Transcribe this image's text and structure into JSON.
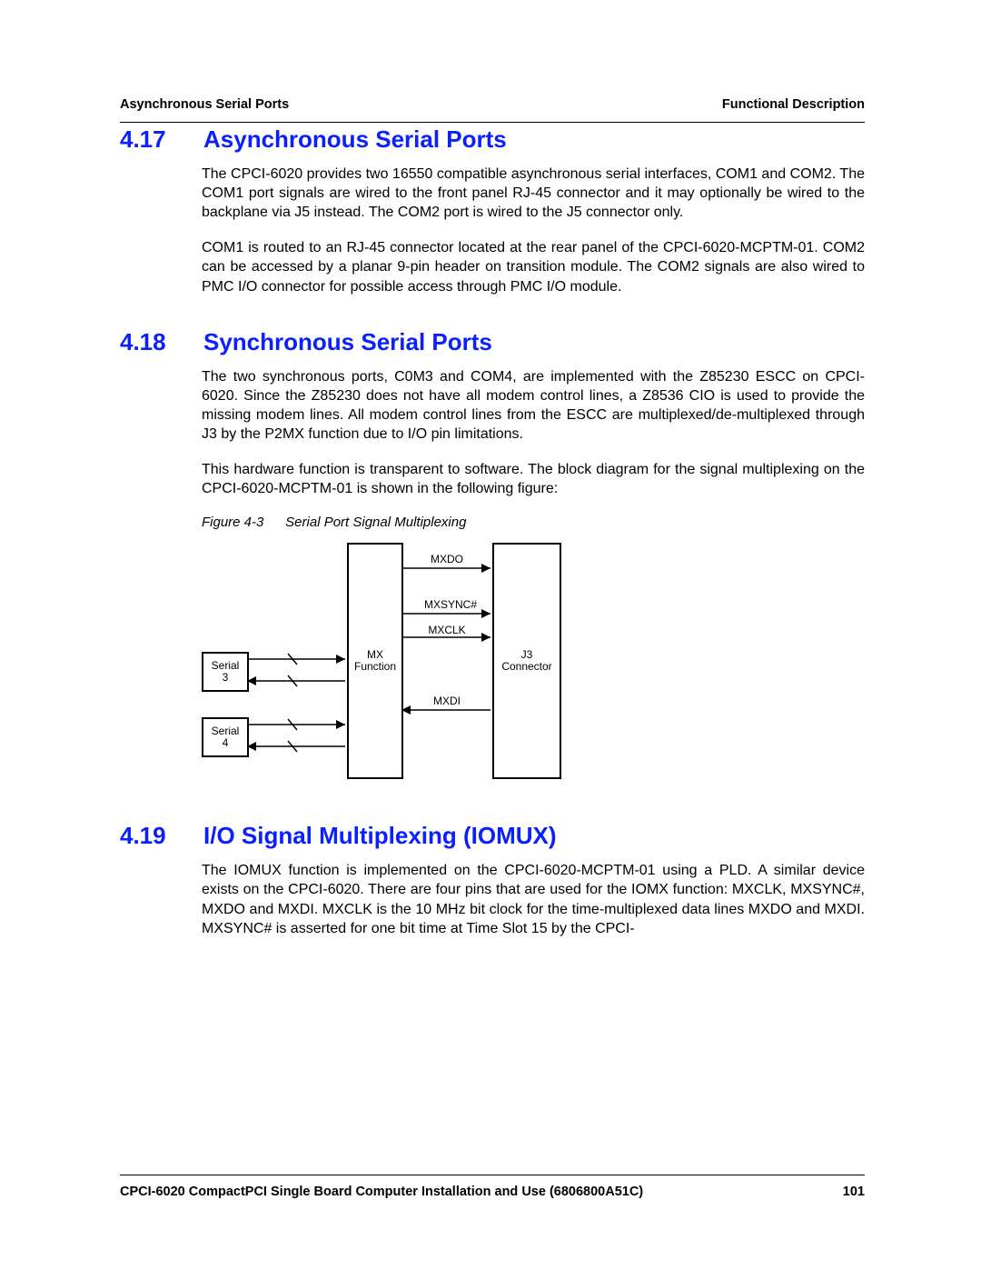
{
  "header": {
    "left": "Asynchronous Serial Ports",
    "right": "Functional Description"
  },
  "sections": [
    {
      "num": "4.17",
      "title": "Asynchronous Serial Ports",
      "paras": [
        "The CPCI-6020 provides two 16550 compatible asynchronous serial interfaces, COM1 and COM2. The COM1 port signals are wired to the front panel RJ-45 connector and it may optionally be wired to the backplane via J5 instead. The COM2 port is wired to the J5 connector only.",
        "COM1 is routed to an RJ-45 connector located at the rear panel of the CPCI-6020-MCPTM-01. COM2 can be accessed by a planar 9-pin header on transition module. The COM2 signals are also wired to PMC I/O connector for possible access through PMC I/O module."
      ]
    },
    {
      "num": "4.18",
      "title": "Synchronous Serial Ports",
      "paras": [
        "The two synchronous ports, C0M3 and COM4, are implemented with the Z85230 ESCC on CPCI-6020. Since the Z85230 does not have all modem control lines, a Z8536 CIO is used to provide the missing modem lines. All modem control lines from the ESCC are multiplexed/de-multiplexed through J3 by the P2MX function due to I/O pin limitations.",
        "This hardware function is transparent to software. The block diagram for the signal multiplexing on the CPCI-6020-MCPTM-01 is shown in the following figure:"
      ]
    },
    {
      "num": "4.19",
      "title": "I/O Signal Multiplexing (IOMUX)",
      "paras": [
        "The IOMUX function is implemented on the CPCI-6020-MCPTM-01 using a PLD. A similar device exists on the CPCI-6020. There are four pins that are used for the IOMX function: MXCLK, MXSYNC#, MXDO and MXDI. MXCLK is the 10 MHz bit clock for the time-multiplexed data lines MXDO and MXDI. MXSYNC# is asserted for one bit time at Time Slot 15 by the CPCI-"
      ]
    }
  ],
  "figure": {
    "num": "Figure 4-3",
    "title": "Serial Port Signal Multiplexing",
    "labels": {
      "serial3": "Serial\n3",
      "serial4": "Serial\n4",
      "mxfunc": "MX\nFunction",
      "j3": "J3\nConnector",
      "mxdo": "MXDO",
      "mxsync": "MXSYNC#",
      "mxclk": "MXCLK",
      "mxdi": "MXDI"
    }
  },
  "footer": {
    "left": "CPCI-6020 CompactPCI Single Board Computer Installation and Use (6806800A51C)",
    "page": "101"
  }
}
